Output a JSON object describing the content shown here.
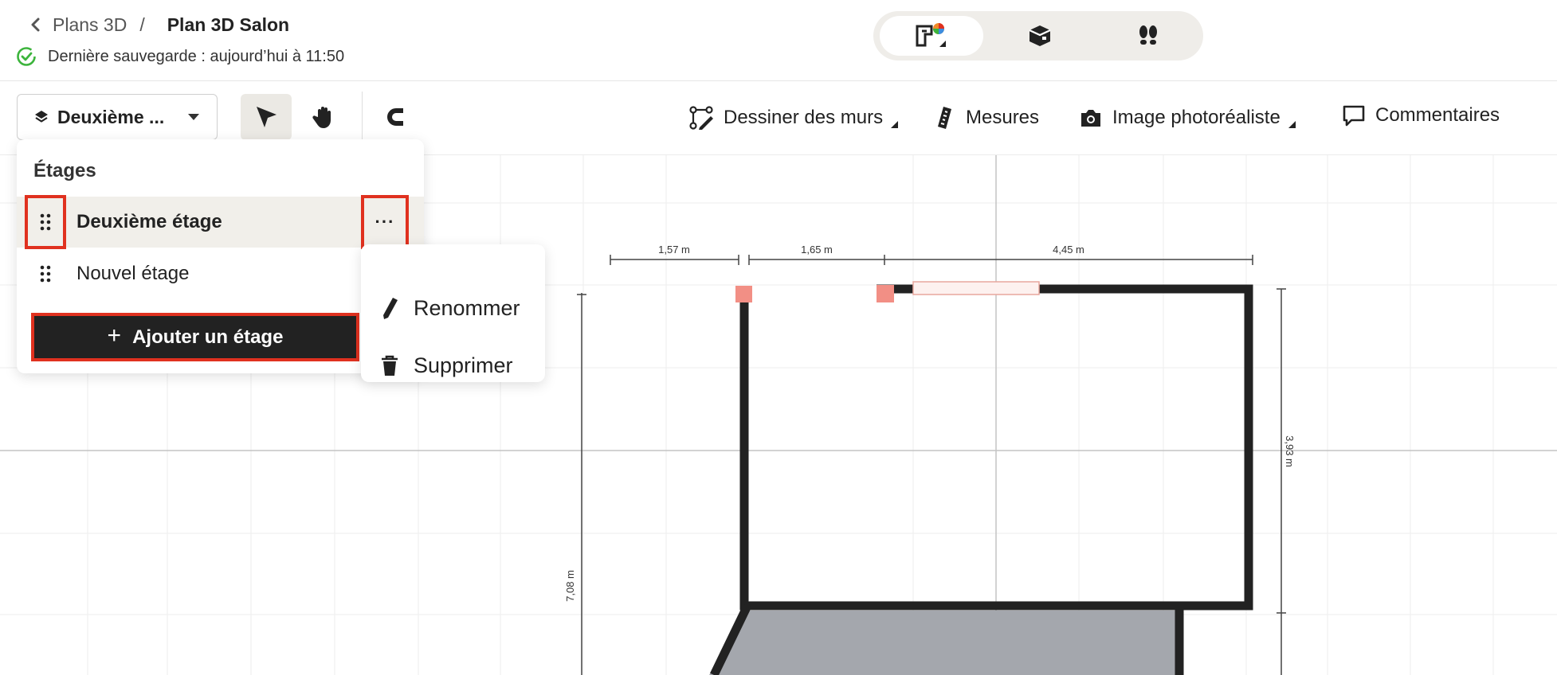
{
  "header": {
    "breadcrumb_parent": "Plans 3D",
    "breadcrumb_separator": "/",
    "plan_title": "Plan 3D Salon",
    "save_status": "Dernière sauvegarde : aujourd’hui à 11:50"
  },
  "view_switch": {
    "modes": [
      {
        "icon": "floorplan-2d-icon",
        "active": true
      },
      {
        "icon": "cube-3d-icon",
        "active": false
      },
      {
        "icon": "footsteps-icon",
        "active": false
      }
    ]
  },
  "toolbar": {
    "floor_select_label": "Deuxième ...",
    "tools": [
      "select-arrow-icon",
      "pan-hand-icon",
      "magnet-icon"
    ],
    "draw_walls": "Dessiner des murs",
    "measures": "Mesures",
    "photo_image": "Image photoréaliste",
    "comments": "Commentaires"
  },
  "floors_panel": {
    "title": "Étages",
    "floors": [
      {
        "name": "Deuxième étage",
        "selected": true
      },
      {
        "name": "Nouvel étage",
        "selected": false
      }
    ],
    "add_floor": "Ajouter un étage",
    "more_label": "···"
  },
  "context_menu": {
    "rename": "Renommer",
    "delete": "Supprimer"
  },
  "plan": {
    "dim_1": "1,57 m",
    "dim_2": "1,65 m",
    "dim_3": "4,45 m",
    "dim_right": "3,93 m",
    "dim_left": "7,08 m"
  },
  "colors": {
    "highlight": "#e0311f",
    "wall": "#222222",
    "floor_fill": "#a4a7ad",
    "corner_marker": "#f28f85",
    "save_ok": "#3cb43c"
  }
}
